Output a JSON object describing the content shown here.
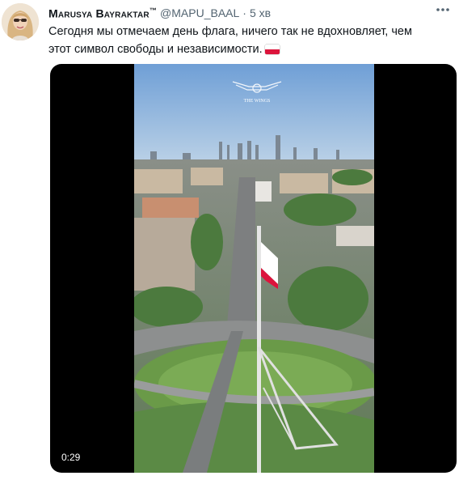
{
  "author": {
    "display_name": "Marusya Bayraktar",
    "display_name_suffix": "™",
    "handle": "@MAPU_BAAL",
    "separator": "·",
    "time": "5 хв"
  },
  "tweet": {
    "text": "Сегодня мы отмечаем день флага, ничего так не вдохновляет, чем этот символ свободы и независимости.",
    "flag_emoji": "poland-flag"
  },
  "video": {
    "duration": "0:29",
    "watermark": "THE WINGS"
  },
  "icons": {
    "more": "more-horizontal-icon"
  },
  "colors": {
    "text_primary": "#0f1419",
    "text_secondary": "#536471",
    "flag_red": "#dc143c",
    "sky_top": "#6f9fd6",
    "grass": "#3f6b34"
  }
}
